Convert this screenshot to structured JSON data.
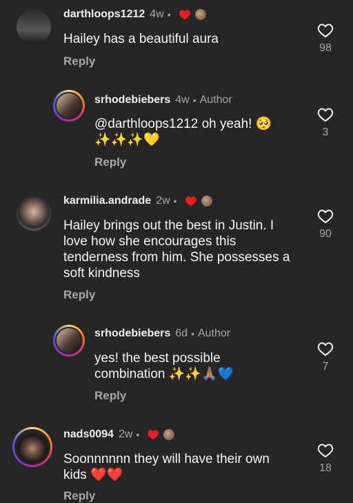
{
  "comments": [
    {
      "username": "darthloops1212",
      "time": "4w",
      "text": "Hailey has a beautiful aura",
      "reply": "Reply",
      "likes": "98"
    },
    {
      "username": "srhodebiebers",
      "time": "4w",
      "author_label": "Author",
      "text": "@darthloops1212 oh yeah! 🥺",
      "text2": "✨✨✨💛",
      "reply": "Reply",
      "likes": "3"
    },
    {
      "username": "karmilia.andrade",
      "time": "2w",
      "text": "Hailey brings out the best in Justin. I love how she encourages this tenderness from him. She possesses a soft kindness",
      "reply": "Reply",
      "likes": "90"
    },
    {
      "username": "srhodebiebers",
      "time": "6d",
      "author_label": "Author",
      "text": "yes! the best possible combination ✨✨🙏🏽💙",
      "reply": "Reply",
      "likes": "7"
    },
    {
      "username": "nads0094",
      "time": "2w",
      "text": "Soonnnnnn they will have their own kids ❤️❤️",
      "reply": "Reply",
      "likes": "18"
    }
  ],
  "colors": {
    "background": "#262626",
    "heart_red": "#ed1c24",
    "muted": "#a8a8a8"
  },
  "icons": {
    "like": "heart-outline-icon",
    "creator_liked": "red-heart-icon"
  }
}
